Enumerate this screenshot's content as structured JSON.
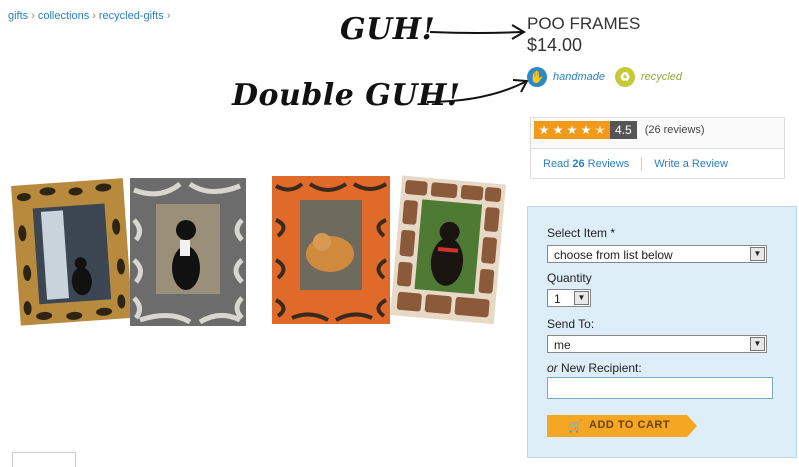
{
  "breadcrumb": {
    "items": [
      "gifts",
      "collections",
      "recycled-gifts"
    ],
    "separator": "›"
  },
  "annotations": {
    "first": "GUH!",
    "second": "Double GUH!"
  },
  "product": {
    "title": "POO FRAMES",
    "price": "$14.00",
    "badges": {
      "handmade": "handmade",
      "recycled": "recycled"
    }
  },
  "rating": {
    "value": "4.5",
    "stars": 4.5,
    "reviews_count_text": "(26 reviews)",
    "read_prefix": "Read ",
    "read_count": "26",
    "read_suffix": " Reviews",
    "write_label": "Write a Review"
  },
  "order": {
    "select_item_label": "Select Item *",
    "select_item_value": "choose from list below",
    "quantity_label": "Quantity",
    "quantity_value": "1",
    "send_to_label": "Send To:",
    "send_to_value": "me",
    "new_recipient_or": "or",
    "new_recipient_label": " New Recipient:",
    "add_to_cart_label": "ADD TO CART"
  },
  "colors": {
    "link": "#2b7fc1",
    "star_bg": "#f29b1b",
    "panel_bg": "#ddeef8",
    "button": "#f5a623"
  },
  "icons": {
    "handmade": "hand-icon",
    "recycled": "recycle-icon",
    "cart": "cart-icon"
  }
}
